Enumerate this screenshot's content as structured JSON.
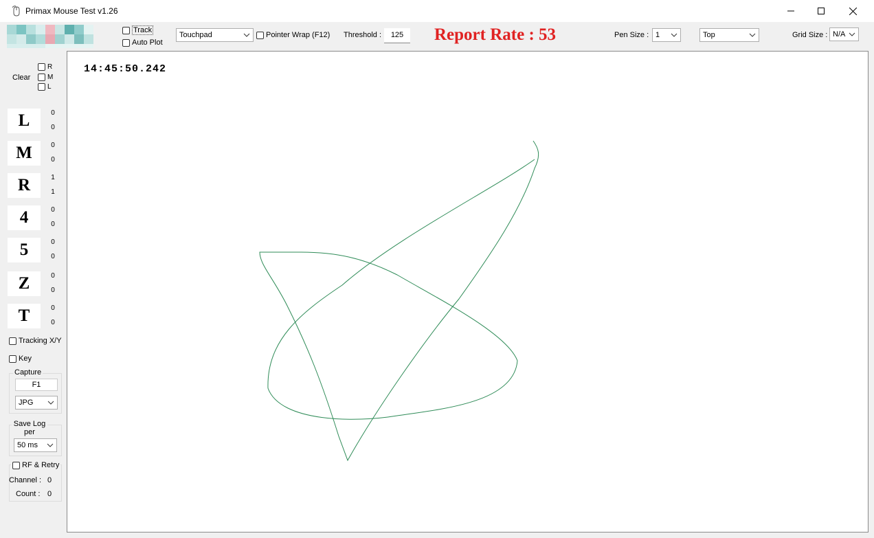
{
  "window": {
    "title": "Primax Mouse Test v1.26"
  },
  "toolbar": {
    "track_label": "Track",
    "auto_plot_label": "Auto Plot",
    "device_value": "Touchpad",
    "pointer_wrap_label": "Pointer Wrap (F12)",
    "threshold_label": "Threshold :",
    "threshold_value": "125",
    "report_rate": "Report Rate : 53",
    "pen_size_label": "Pen Size :",
    "pen_size_value": "1",
    "position_value": "Top",
    "grid_size_label": "Grid Size :",
    "grid_size_value": "N/A"
  },
  "left": {
    "clear_label": "Clear",
    "clear_r": "R",
    "clear_m": "M",
    "clear_l": "L",
    "buttons": [
      {
        "label": "L",
        "c1": "0",
        "c2": "0"
      },
      {
        "label": "M",
        "c1": "0",
        "c2": "0"
      },
      {
        "label": "R",
        "c1": "1",
        "c2": "1"
      },
      {
        "label": "4",
        "c1": "0",
        "c2": "0"
      },
      {
        "label": "5",
        "c1": "0",
        "c2": "0"
      },
      {
        "label": "Z",
        "c1": "0",
        "c2": "0"
      },
      {
        "label": "T",
        "c1": "0",
        "c2": "0"
      }
    ],
    "tracking_label": "Tracking X/Y",
    "key_label": "Key",
    "capture_label": "Capture",
    "capture_key": "F1",
    "capture_format": "JPG",
    "save_log_label": "Save Log per",
    "save_log_value": "50 ms",
    "rf_retry_label": "RF & Retry",
    "channel_label": "Channel :",
    "channel_value": "0",
    "count_label": "Count :",
    "count_value": "0"
  },
  "canvas": {
    "timestamp": "14:45:50.242",
    "trace_color": "#2e8b57"
  },
  "colors": {
    "report_rate": "#e02222"
  }
}
